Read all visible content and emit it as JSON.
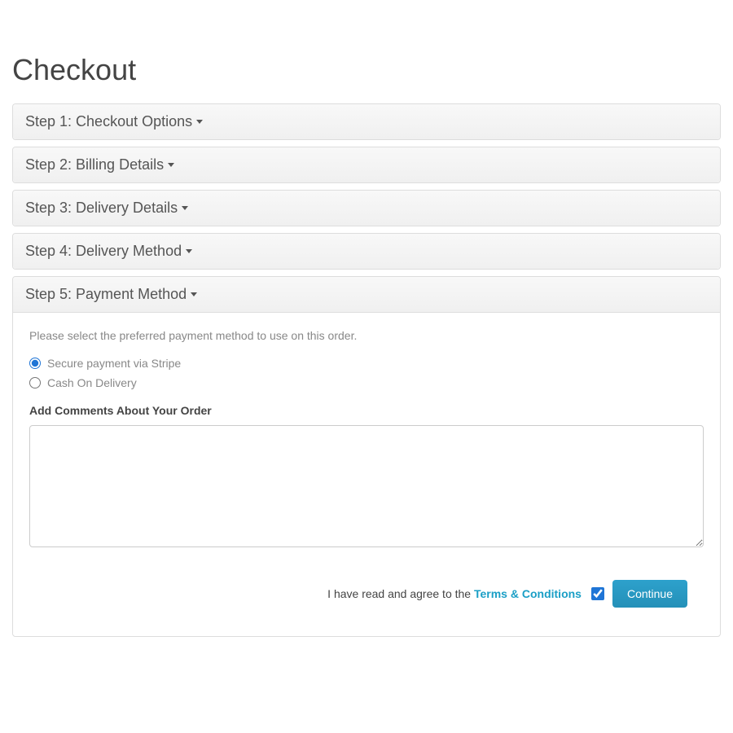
{
  "page_title": "Checkout",
  "steps": {
    "step1": "Step 1: Checkout Options",
    "step2": "Step 2: Billing Details",
    "step3": "Step 3: Delivery Details",
    "step4": "Step 4: Delivery Method",
    "step5": "Step 5: Payment Method"
  },
  "payment": {
    "instruction": "Please select the preferred payment method to use on this order.",
    "options": {
      "stripe": "Secure payment via Stripe",
      "cod": "Cash On Delivery"
    },
    "comments_label": "Add Comments About Your Order"
  },
  "footer": {
    "agree_prefix": "I have read and agree to the ",
    "terms_link": "Terms & Conditions",
    "continue_button": "Continue"
  }
}
